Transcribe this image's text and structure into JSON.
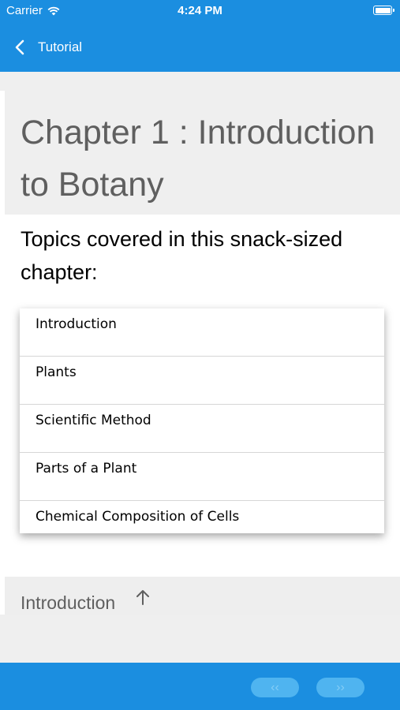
{
  "status_bar": {
    "carrier": "Carrier",
    "time": "4:24 PM"
  },
  "nav": {
    "back_label": "Tutorial"
  },
  "chapter": {
    "title": "Chapter 1 : Introduction to Botany",
    "topics_intro": "Topics covered in this snack-sized chapter:",
    "topics": [
      {
        "label": "Introduction"
      },
      {
        "label": "Plants"
      },
      {
        "label": "Scientific Method"
      },
      {
        "label": "Parts of a Plant"
      },
      {
        "label": "Chemical Composition of Cells"
      }
    ]
  },
  "section": {
    "title": "Introduction",
    "icon": "arrow-up-icon"
  },
  "pager": {
    "prev_label": "‹‹",
    "next_label": "››"
  },
  "colors": {
    "accent": "#1b8ee0",
    "header_bg": "#efefef",
    "header_text": "#5f5f5f",
    "pager_button": "#4fb4f0"
  }
}
